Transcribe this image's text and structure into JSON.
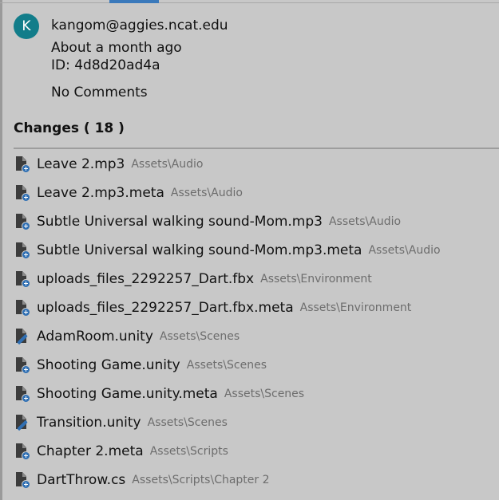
{
  "commit": {
    "avatar_letter": "K",
    "author": "kangom@aggies.ncat.edu",
    "time": "About a month ago",
    "id_text": "ID: 4d8d20ad4a",
    "comments": "No Comments"
  },
  "changes": {
    "header": "Changes ( 18 )",
    "items": [
      {
        "name": "Leave 2.mp3",
        "path": "Assets\\Audio",
        "icon": "file-added-icon"
      },
      {
        "name": "Leave 2.mp3.meta",
        "path": "Assets\\Audio",
        "icon": "file-added-icon"
      },
      {
        "name": "Subtle Universal walking sound-Mom.mp3",
        "path": "Assets\\Audio",
        "icon": "file-added-icon"
      },
      {
        "name": "Subtle Universal walking sound-Mom.mp3.meta",
        "path": "Assets\\Audio",
        "icon": "file-added-icon"
      },
      {
        "name": "uploads_files_2292257_Dart.fbx",
        "path": "Assets\\Environment",
        "icon": "file-added-icon"
      },
      {
        "name": "uploads_files_2292257_Dart.fbx.meta",
        "path": "Assets\\Environment",
        "icon": "file-added-icon"
      },
      {
        "name": "AdamRoom.unity",
        "path": "Assets\\Scenes",
        "icon": "file-modified-icon"
      },
      {
        "name": "Shooting Game.unity",
        "path": "Assets\\Scenes",
        "icon": "file-added-icon"
      },
      {
        "name": "Shooting Game.unity.meta",
        "path": "Assets\\Scenes",
        "icon": "file-added-icon"
      },
      {
        "name": "Transition.unity",
        "path": "Assets\\Scenes",
        "icon": "file-modified-icon"
      },
      {
        "name": "Chapter 2.meta",
        "path": "Assets\\Scripts",
        "icon": "file-added-icon"
      },
      {
        "name": "DartThrow.cs",
        "path": "Assets\\Scripts\\Chapter 2",
        "icon": "file-added-icon"
      }
    ]
  },
  "colors": {
    "background": "#c8c8c8",
    "avatar": "#127d8a",
    "accent": "#3a79bb",
    "path_text": "#6d6d6d"
  }
}
